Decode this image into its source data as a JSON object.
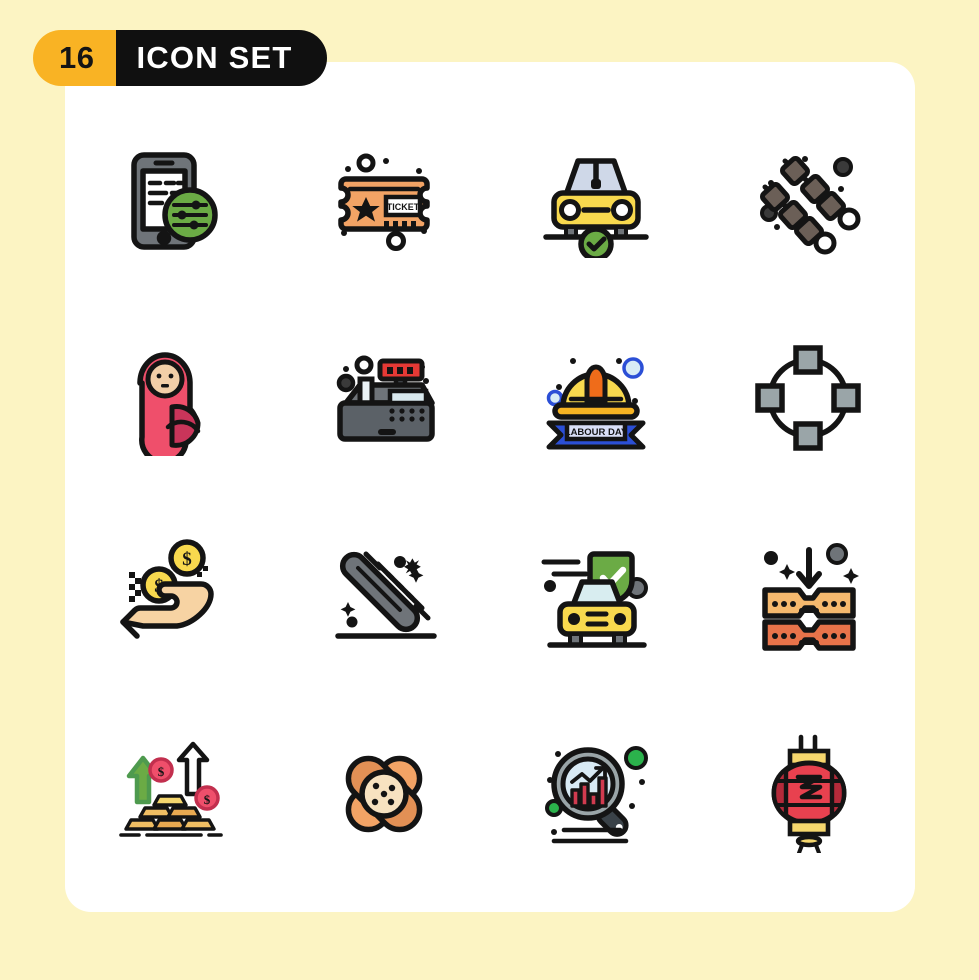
{
  "header": {
    "count": "16",
    "title": "ICON SET"
  },
  "colors": {
    "page_background": "#FCF4C3",
    "card_background": "#FFFFFF",
    "badge_count_bg": "#F9B324",
    "badge_title_bg": "#101010",
    "badge_title_text": "#FFFFFF",
    "outline": "#141414",
    "green": "#6BAB45",
    "green_dark": "#4E9A4E",
    "yellow": "#F8D94E",
    "orange": "#F2A365",
    "orange_deep": "#E8734A",
    "pink": "#EF4F6B",
    "blue": "#2B4FD6",
    "grey": "#6F7479",
    "grey_light": "#9AA5A8",
    "red": "#DD3E4E"
  },
  "grid": {
    "rows": 4,
    "columns": 4
  },
  "icons": [
    {
      "index": 1,
      "name": "mobile-settings-icon",
      "label": "Mobile Settings",
      "row": 1,
      "col": 1
    },
    {
      "index": 2,
      "name": "ticket-icon",
      "label": "Ticket",
      "row": 1,
      "col": 2,
      "text": "TICKET"
    },
    {
      "index": 3,
      "name": "car-approved-icon",
      "label": "Car Approved",
      "row": 1,
      "col": 3
    },
    {
      "index": 4,
      "name": "skewers-icon",
      "label": "Skewers",
      "row": 1,
      "col": 4
    },
    {
      "index": 5,
      "name": "swaddled-baby-icon",
      "label": "Swaddled Baby",
      "row": 2,
      "col": 1
    },
    {
      "index": 6,
      "name": "cash-register-icon",
      "label": "Cash Register",
      "row": 2,
      "col": 2
    },
    {
      "index": 7,
      "name": "labour-day-helmet-icon",
      "label": "Labour Day Helmet",
      "row": 2,
      "col": 3,
      "text": "LABOUR DAY"
    },
    {
      "index": 8,
      "name": "vector-path-nodes-icon",
      "label": "Vector Path Nodes",
      "row": 2,
      "col": 4
    },
    {
      "index": 9,
      "name": "hand-receiving-coins-icon",
      "label": "Hand Receiving Coins",
      "row": 3,
      "col": 1,
      "text": "$"
    },
    {
      "index": 10,
      "name": "rake-icon",
      "label": "Rake",
      "row": 3,
      "col": 2
    },
    {
      "index": 11,
      "name": "car-insurance-icon",
      "label": "Car Insurance",
      "row": 3,
      "col": 3
    },
    {
      "index": 12,
      "name": "press-layers-icon",
      "label": "Press Layers",
      "row": 3,
      "col": 4
    },
    {
      "index": 13,
      "name": "gold-bars-growth-icon",
      "label": "Gold Bars Growth",
      "row": 4,
      "col": 1,
      "text": "$"
    },
    {
      "index": 14,
      "name": "crossed-bandages-icon",
      "label": "Crossed Bandages",
      "row": 4,
      "col": 2
    },
    {
      "index": 15,
      "name": "market-analysis-icon",
      "label": "Market Analysis",
      "row": 4,
      "col": 3
    },
    {
      "index": 16,
      "name": "chinese-lantern-icon",
      "label": "Chinese Lantern",
      "row": 4,
      "col": 4
    }
  ]
}
